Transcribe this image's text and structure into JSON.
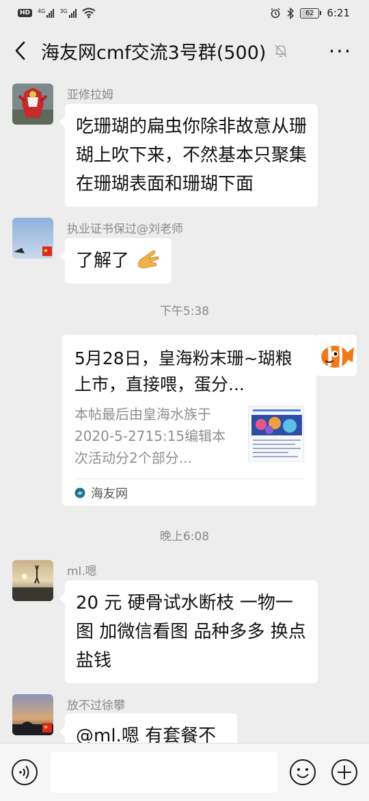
{
  "status_bar": {
    "hd": "HD",
    "net1": "4G",
    "net2": "3G",
    "battery": "62",
    "time": "6:21",
    "icons": [
      "hd-icon",
      "signal-icon",
      "wifi-icon",
      "alarm-icon",
      "bluetooth-icon",
      "battery-icon"
    ]
  },
  "header": {
    "title": "海友网cmf交流3号群(500)",
    "icons": [
      "back-arrow-icon",
      "mute-bell-icon",
      "more-dots-icon"
    ],
    "more_label": "···"
  },
  "messages": [
    {
      "sender": "亚修拉姆",
      "text": "吃珊瑚的扁虫你除非故意从珊瑚上吹下来，不然基本只聚集在珊瑚表面和珊瑚下面"
    },
    {
      "sender": "执业证书保过@刘老师",
      "text": "了解了"
    },
    {
      "time": "下午5:38"
    },
    {
      "link_card": {
        "title": "5月28日，皇海粉末珊~瑚粮上市，直接喂，蛋分...",
        "desc": "本帖最后由皇海水族于2020-5-2715:15编辑本次活动分2个部分...",
        "source": "海友网"
      }
    },
    {
      "time": "晚上6:08"
    },
    {
      "sender": "ml.嗯",
      "text": "20 元 硬骨试水断枝 一物一图 加微信看图 品种多多 换点盐钱"
    },
    {
      "sender": "放不过徐攀",
      "text": "@ml.嗯  有套餐不"
    }
  ],
  "input_bar": {
    "placeholder": "",
    "icons": [
      "voice-icon",
      "emoji-icon",
      "plus-icon"
    ]
  },
  "colors": {
    "background": "#ededed",
    "bubble": "#ffffff",
    "meta_text": "#8a8a8a"
  }
}
